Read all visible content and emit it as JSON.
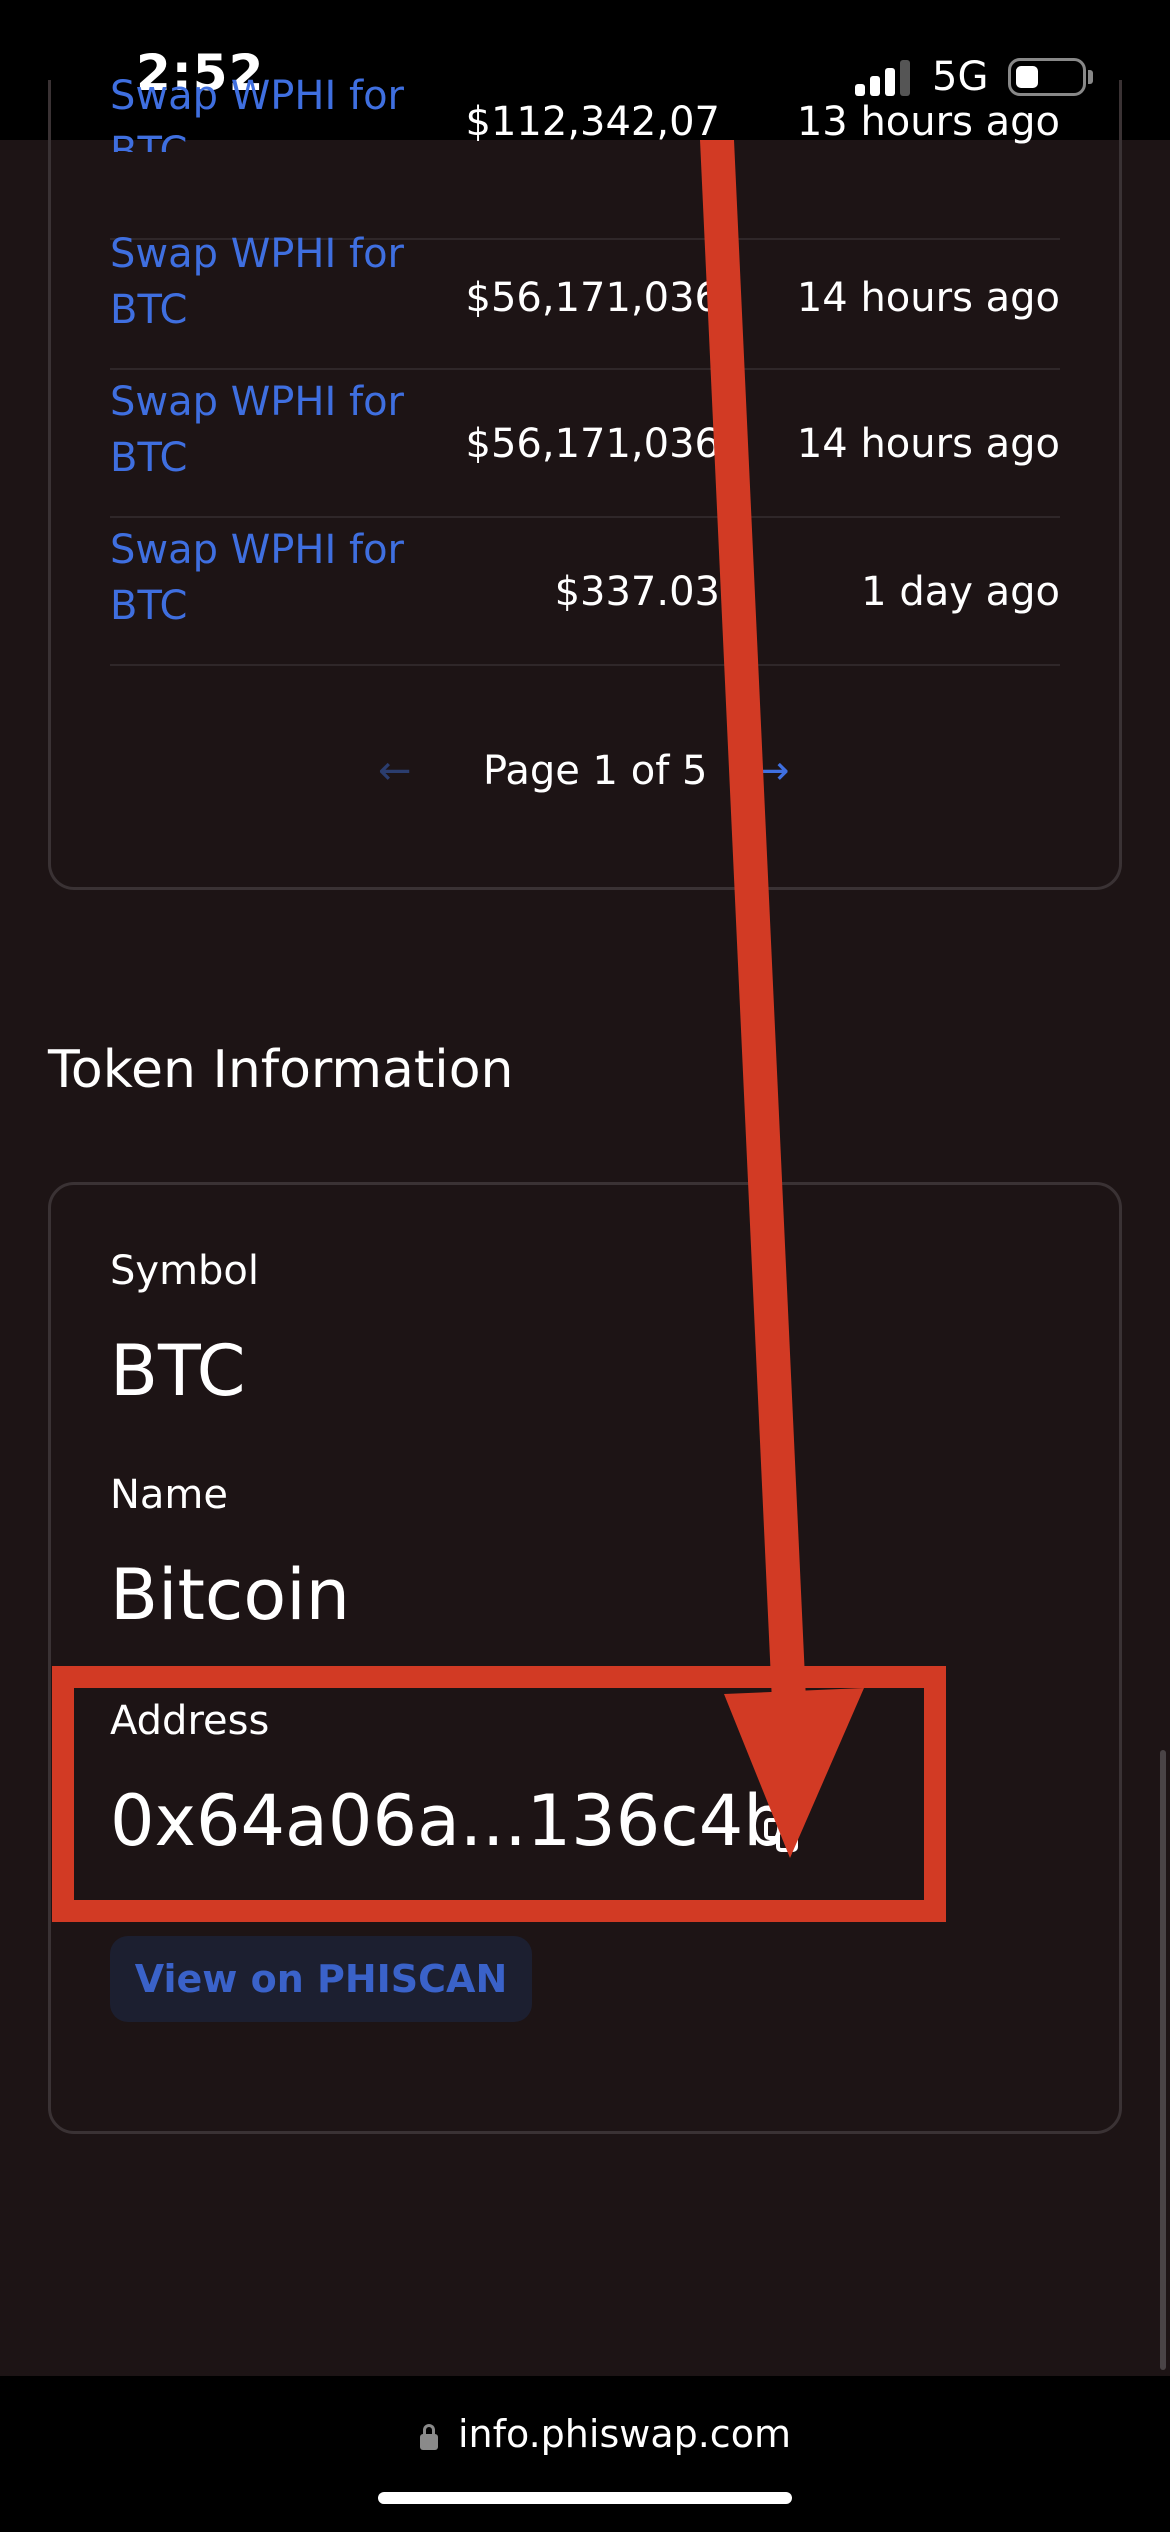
{
  "status_bar": {
    "time": "2:52",
    "network": "5G",
    "battery_level": 0.35
  },
  "transactions": [
    {
      "name": "Swap WPHI for BTC",
      "value": "$112,342,07",
      "time": "13 hours ago"
    },
    {
      "name": "Swap WPHI for BTC",
      "value": "$56,171,036",
      "time": "14 hours ago"
    },
    {
      "name": "Swap WPHI for BTC",
      "value": "$56,171,036",
      "time": "14 hours ago"
    },
    {
      "name": "Swap WPHI for BTC",
      "value": "$337.03",
      "time": "1 day ago"
    }
  ],
  "pagination": {
    "prev": "←",
    "label": "Page 1 of 5",
    "next": "→"
  },
  "token_info": {
    "title": "Token Information",
    "symbol_label": "Symbol",
    "symbol": "BTC",
    "name_label": "Name",
    "name": "Bitcoin",
    "address_label": "Address",
    "address": "0x64a06a...136c4b",
    "explorer_button": "View on PHISCAN"
  },
  "browser": {
    "url": "info.phiswap.com"
  },
  "colors": {
    "background": "#1d1415",
    "link": "#3f6fe0",
    "annotation": "#d23a24"
  },
  "icons": [
    "signal-icon",
    "battery-icon",
    "copy-icon",
    "lock-icon"
  ]
}
